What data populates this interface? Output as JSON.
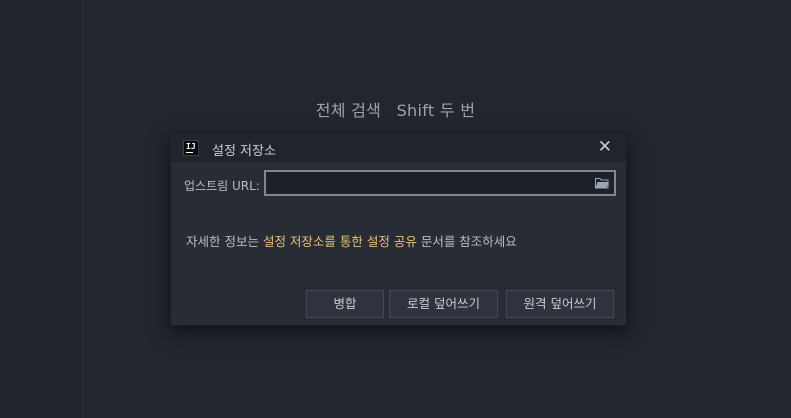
{
  "editor": {
    "hint_label": "전체 검색",
    "hint_shortcut": "Shift 두 번"
  },
  "dialog": {
    "title": "설정 저장소",
    "close_symbol": "✕",
    "app_icon_text": "IJ",
    "url_label": "업스트림 URL:",
    "url_value": "",
    "info_prefix": "자세한 정보는 ",
    "info_link": "설정 저장소를 통한 설정 공유",
    "info_suffix": " 문서를 참조하세요",
    "buttons": {
      "merge": "병합",
      "overwrite_local": "로컬 덮어쓰기",
      "overwrite_remote": "원격 덮어쓰기"
    }
  },
  "colors": {
    "background": "#23262e",
    "dialog": "#282c34",
    "link": "#e5c07b",
    "folder_icon": "#9aa7b8"
  }
}
